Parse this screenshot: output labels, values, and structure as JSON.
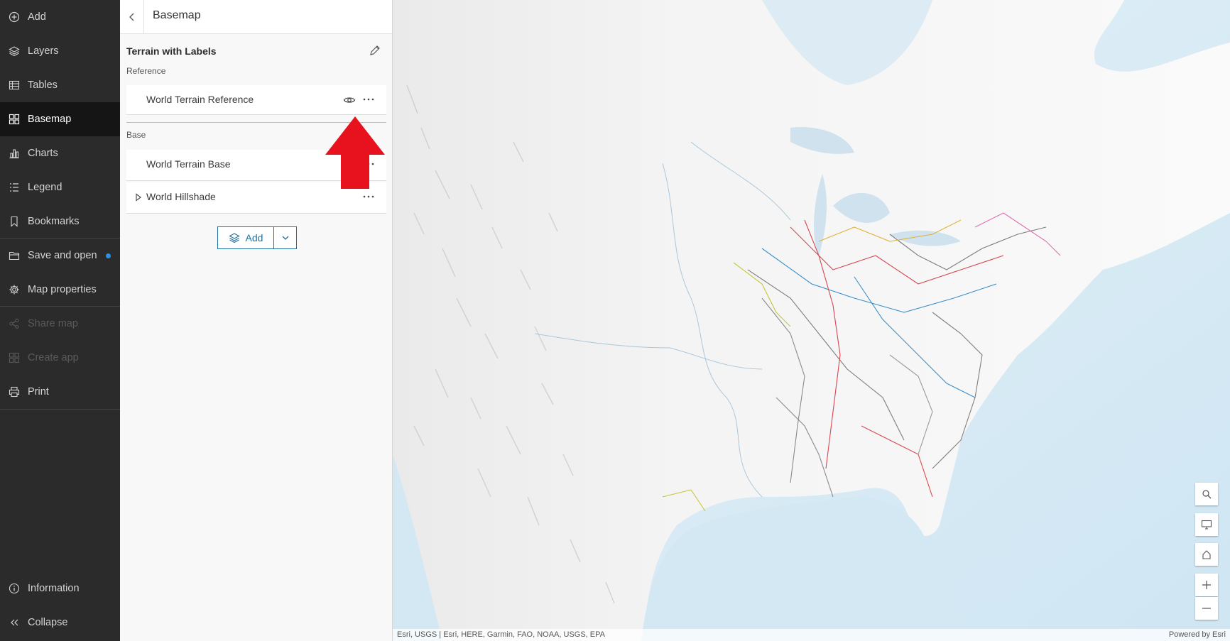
{
  "nav": {
    "items": [
      {
        "label": "Add",
        "icon": "plus-circle-icon"
      },
      {
        "label": "Layers",
        "icon": "layers-icon"
      },
      {
        "label": "Tables",
        "icon": "table-icon"
      },
      {
        "label": "Basemap",
        "icon": "basemap-icon",
        "active": true
      },
      {
        "label": "Charts",
        "icon": "chart-icon"
      },
      {
        "label": "Legend",
        "icon": "legend-icon"
      },
      {
        "label": "Bookmarks",
        "icon": "bookmark-icon"
      },
      {
        "label": "Save and open",
        "icon": "folder-icon",
        "notification": true
      },
      {
        "label": "Map properties",
        "icon": "gear-icon"
      },
      {
        "label": "Share map",
        "icon": "share-icon",
        "disabled": true
      },
      {
        "label": "Create app",
        "icon": "apps-icon",
        "disabled": true
      },
      {
        "label": "Print",
        "icon": "print-icon"
      }
    ],
    "bottom": [
      {
        "label": "Information",
        "icon": "info-icon"
      },
      {
        "label": "Collapse",
        "icon": "collapse-icon"
      }
    ]
  },
  "panel": {
    "title": "Basemap",
    "basemap_name": "Terrain with Labels",
    "reference_label": "Reference",
    "base_label": "Base",
    "reference_layers": [
      {
        "name": "World Terrain Reference"
      }
    ],
    "base_layers": [
      {
        "name": "World Terrain Base"
      },
      {
        "name": "World Hillshade"
      }
    ],
    "add_label": "Add"
  },
  "map": {
    "attribution": "Esri, USGS | Esri, HERE, Garmin, FAO, NOAA, USGS, EPA",
    "powered_by": "Powered by Esri",
    "controls": [
      "search-icon",
      "screen-icon",
      "home-icon",
      "zoom-in-icon",
      "zoom-out-icon"
    ]
  },
  "colors": {
    "nav_bg": "#2b2b2b",
    "nav_active_bg": "#151515",
    "accent": "#1e6f9c",
    "arrow": "#e8121f",
    "notification_dot": "#2e8fe6"
  }
}
